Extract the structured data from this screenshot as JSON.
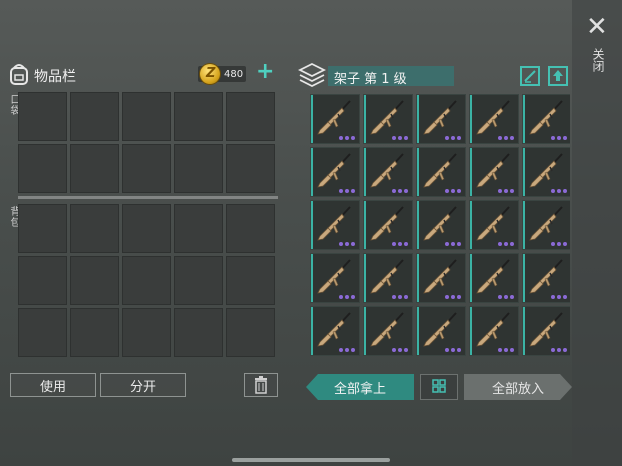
{
  "inventory": {
    "title": "物品栏",
    "coins": "480",
    "coin_symbol": "Z",
    "add_symbol": "+",
    "pocket_label": "口袋",
    "backpack_label": "背包",
    "pocket_rows": 2,
    "backpack_rows": 3,
    "columns": 5
  },
  "left_buttons": {
    "use": "使用",
    "split": "分开"
  },
  "shelf": {
    "title": "架子 第 1 级",
    "item_name": "rifle",
    "visible_rows": 6,
    "columns": 5
  },
  "right_buttons": {
    "take_all": "全部拿上",
    "put_all": "全部放入"
  },
  "side": {
    "close_symbol": "✕",
    "close_label": "关闭"
  },
  "colors": {
    "accent": "#45c1b3",
    "rarity": "#8b6ad6",
    "primary_button": "#2f8a80"
  }
}
